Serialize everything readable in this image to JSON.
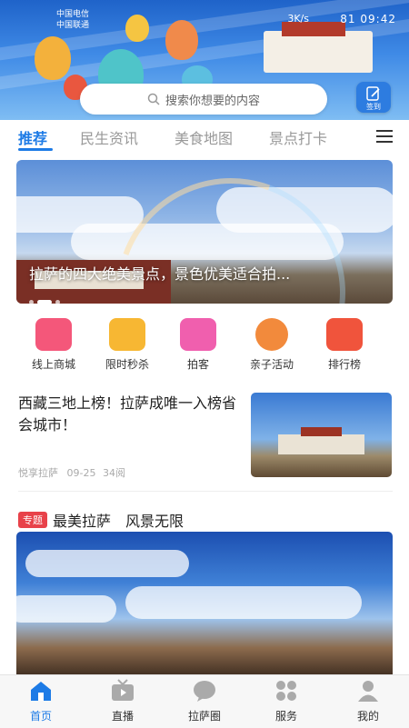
{
  "status_bar": {
    "carrier1": "中国电信",
    "carrier2": "中国联通",
    "speed": "3K/s",
    "battery": "81",
    "time": "09:42"
  },
  "search": {
    "placeholder": "搜索你想要的内容"
  },
  "signin": {
    "label": "签到"
  },
  "tabs": [
    {
      "label": "推荐",
      "active": true
    },
    {
      "label": "民生资讯"
    },
    {
      "label": "美食地图"
    },
    {
      "label": "景点打卡"
    }
  ],
  "hero": {
    "title": "拉萨的四大绝美景点，景色优美适合拍..."
  },
  "quick_menu": [
    {
      "label": "线上商城",
      "icon": "shopping-bag-icon",
      "color": "#f4577a"
    },
    {
      "label": "限时秒杀",
      "icon": "gift-icon",
      "color": "#f7b733"
    },
    {
      "label": "拍客",
      "icon": "camera-icon",
      "color": "#f05fae"
    },
    {
      "label": "亲子活动",
      "icon": "family-icon",
      "color": "#f28a3c"
    },
    {
      "label": "排行榜",
      "icon": "trophy-icon",
      "color": "#f0543c"
    }
  ],
  "news": {
    "title": "西藏三地上榜！拉萨成唯一入榜省会城市！",
    "source": "悦享拉萨",
    "date": "09-25",
    "reads": "34阅"
  },
  "special": {
    "badge": "专题",
    "title": "最美拉萨　风景无限"
  },
  "bottom_nav": [
    {
      "label": "首页",
      "active": true
    },
    {
      "label": "直播"
    },
    {
      "label": "拉萨圈"
    },
    {
      "label": "服务"
    },
    {
      "label": "我的"
    }
  ],
  "colors": {
    "accent": "#1d7be6",
    "badge": "#e8424a"
  }
}
